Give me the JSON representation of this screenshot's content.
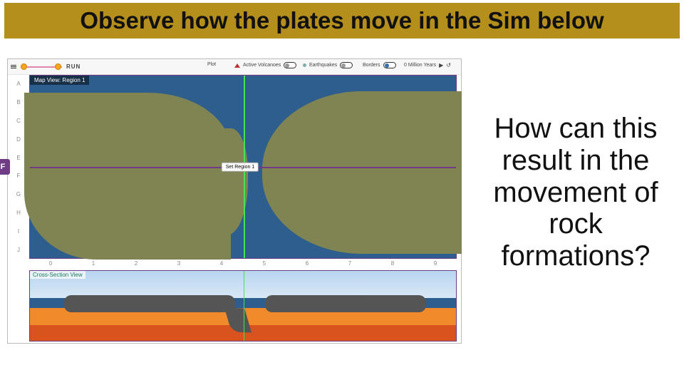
{
  "title": "Observe how the plates move in the Sim below",
  "question": "How can this result in the movement of rock formations?",
  "sim": {
    "run_label": "RUN",
    "map_label": "Map View: Region 1",
    "cs_label": "Cross-Section View",
    "callout": "Set Region 1",
    "f_badge": "F",
    "tb": {
      "plot_label": "Plot",
      "volcanoes": "Active Volcanoes",
      "earthquakes": "Earthquakes",
      "boundaries": "Borders",
      "time": "0 Million Years",
      "play": "▶",
      "reset": "↺"
    },
    "rows": [
      "A",
      "B",
      "C",
      "D",
      "E",
      "F",
      "G",
      "H",
      "I",
      "J"
    ],
    "cols": [
      "0",
      "1",
      "2",
      "3",
      "4",
      "5",
      "6",
      "7",
      "8",
      "9"
    ]
  }
}
